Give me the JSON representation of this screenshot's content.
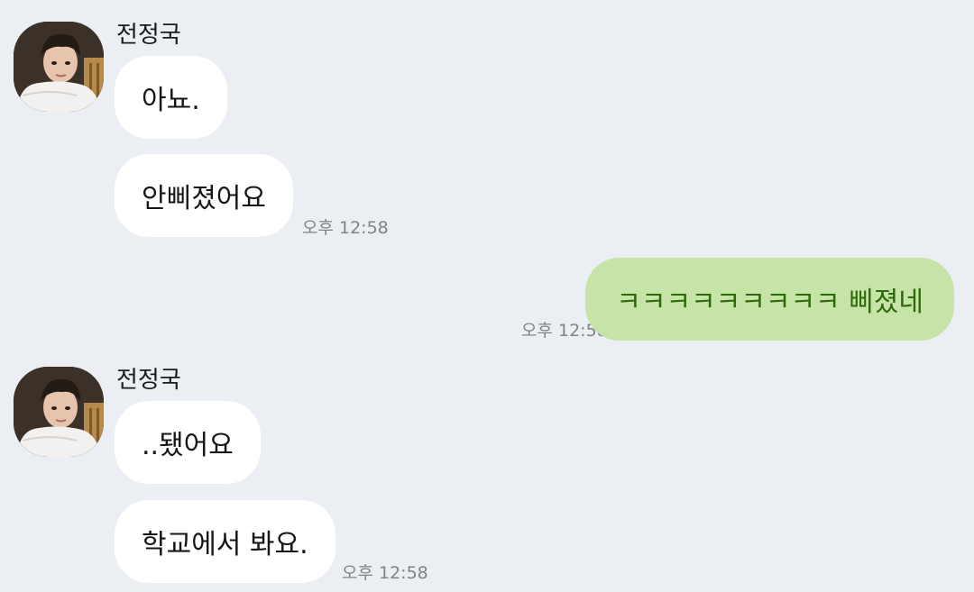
{
  "messages": [
    {
      "sender": "전정국",
      "bubbles": [
        {
          "text": "아뇨."
        },
        {
          "text": "안삐졌어요",
          "time": "오후 12:58"
        }
      ]
    },
    {
      "self": true,
      "bubbles": [
        {
          "text": "ㅋㅋㅋㅋㅋㅋㅋㅋㅋ 삐졌네",
          "time": "오후 12:58"
        }
      ]
    },
    {
      "sender": "전정국",
      "bubbles": [
        {
          "text": "..됐어요"
        },
        {
          "text": "학교에서 봐요.",
          "time": "오후 12:58"
        }
      ]
    }
  ],
  "colors": {
    "background": "#ebeef2",
    "incoming_bubble": "#ffffff",
    "outgoing_bubble": "#c6e4a7",
    "outgoing_text": "#2f6a0a",
    "timestamp": "#808488"
  },
  "icons": [
    "profile-avatar-photo"
  ]
}
